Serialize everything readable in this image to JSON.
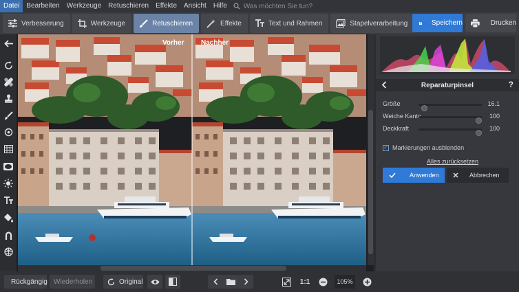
{
  "menu": {
    "items": [
      "Datei",
      "Bearbeiten",
      "Werkzeuge",
      "Retuschieren",
      "Effekte",
      "Ansicht",
      "Hilfe"
    ],
    "active_index": 0,
    "search_placeholder": "Was möchten Sie tun?"
  },
  "toolbar": {
    "tabs": [
      {
        "label": "Verbesserung",
        "icon": "sliders-icon"
      },
      {
        "label": "Werkzeuge",
        "icon": "crop-icon"
      },
      {
        "label": "Retuschieren",
        "icon": "brush-icon"
      },
      {
        "label": "Effekte",
        "icon": "magic-wand-icon"
      },
      {
        "label": "Text und Rahmen",
        "icon": "text-icon"
      },
      {
        "label": "Stapelverarbeitung",
        "icon": "batch-icon"
      }
    ],
    "active_tab_index": 2,
    "save_label": "Speichern",
    "print_label": "Drucken",
    "accent_color": "#2f7ad6"
  },
  "left_tools": [
    "back-arrow-icon",
    "rotate-icon",
    "healing-icon",
    "stamp-icon",
    "brush-icon",
    "target-icon",
    "grid-icon",
    "vignette-icon",
    "sun-icon",
    "text-icon",
    "fill-icon",
    "lasso-icon",
    "globe-icon"
  ],
  "canvas": {
    "before_label": "Vorher",
    "after_label": "Nachher"
  },
  "panel": {
    "title": "Reparaturpinsel",
    "sliders": [
      {
        "label": "Größe",
        "value": "16.1",
        "position": 0.05
      },
      {
        "label": "Weiche Kante",
        "value": "100",
        "position": 1.0
      },
      {
        "label": "Deckkraft",
        "value": "100",
        "position": 1.0
      }
    ],
    "checkbox_label": "Markierungen ausblenden",
    "checkbox_checked": true,
    "reset_label": "Alles zurücksetzen",
    "apply_label": "Anwenden",
    "cancel_label": "Abbrechen"
  },
  "bottom": {
    "undo_label": "Rückgängig",
    "redo_label": "Wiederholen",
    "original_label": "Original",
    "ratio_label": "1:1",
    "zoom_value": "105%"
  }
}
